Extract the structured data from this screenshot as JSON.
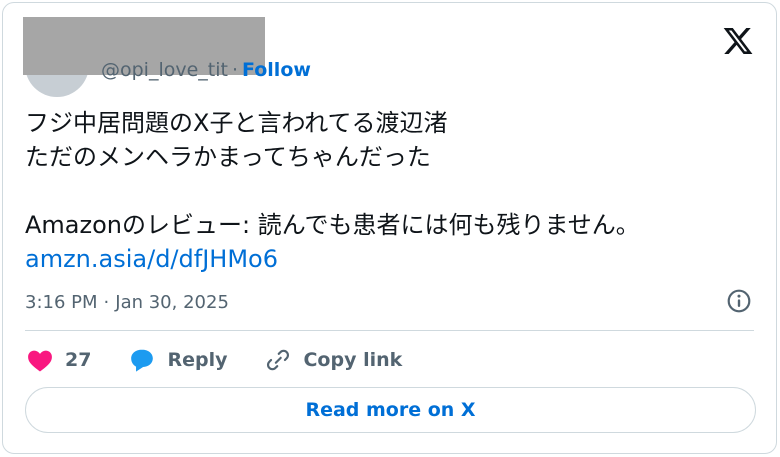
{
  "author": {
    "handle": "@opi_love_tit",
    "separator": "·",
    "follow_label": "Follow"
  },
  "tweet": {
    "line1": "フジ中居問題のX子と言われてる渡辺渚",
    "line2": "ただのメンヘラかまってちゃんだった",
    "line3": "Amazonのレビュー: 読んでも患者には何も残りません。",
    "link": "amzn.asia/d/dfJHMo6"
  },
  "meta": {
    "time": "3:16 PM",
    "separator": "·",
    "date": "Jan 30, 2025"
  },
  "actions": {
    "like_count": "27",
    "reply_label": "Reply",
    "copy_label": "Copy link"
  },
  "read_more_label": "Read more on X",
  "colors": {
    "link": "#006fd6",
    "like": "#f91880",
    "reply": "#1d9bf0",
    "muted": "#536471",
    "border": "#cfd9de"
  },
  "icons": [
    "x-logo-icon",
    "info-icon",
    "heart-icon",
    "reply-bubble-icon",
    "link-icon"
  ]
}
